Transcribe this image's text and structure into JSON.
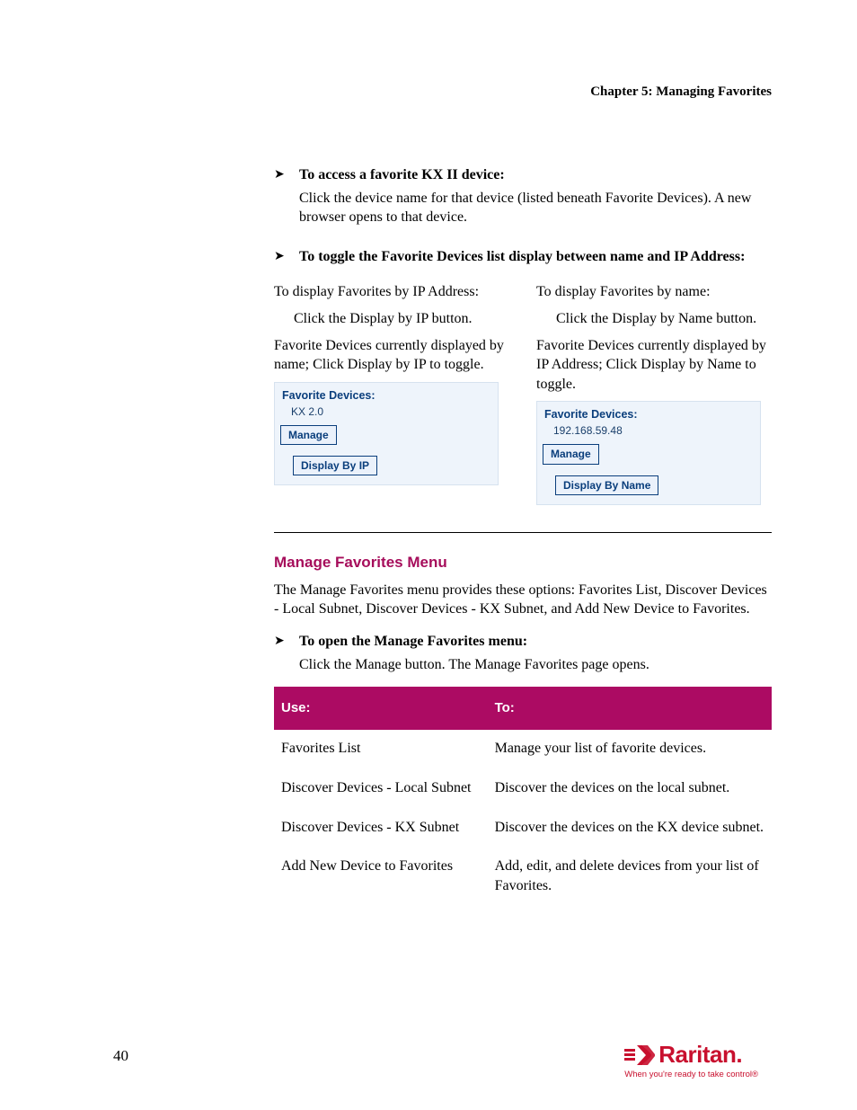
{
  "runningHead": "Chapter 5: Managing Favorites",
  "sec1": {
    "task1": {
      "title": "To access a favorite KX II device:",
      "body": "Click the device name for that device (listed beneath Favorite Devices). A new browser opens to that device."
    },
    "task2": {
      "title": "To toggle the Favorite Devices list display between name and IP Address:",
      "left": {
        "line1": "To display Favorites by IP Address:",
        "step": "Click the Display by IP button.",
        "line2": "Favorite Devices currently displayed by name; Click Display by IP to toggle."
      },
      "right": {
        "line1": "To display Favorites by name:",
        "step": "Click the Display by Name button.",
        "line2": "Favorite Devices currently displayed by IP Address; Click Display by Name to toggle."
      },
      "widgetLeft": {
        "title": "Favorite Devices:",
        "item": "KX 2.0",
        "btn1": "Manage",
        "btn2": "Display By IP"
      },
      "widgetRight": {
        "title": "Favorite Devices:",
        "item": "192.168.59.48",
        "btn1": "Manage",
        "btn2": "Display By Name"
      }
    }
  },
  "sec2": {
    "heading": "Manage Favorites Menu",
    "intro": "The Manage Favorites menu provides these options: Favorites List, Discover Devices - Local Subnet, Discover Devices - KX Subnet, and Add New Device to Favorites.",
    "task": {
      "title": "To open the Manage Favorites menu:",
      "body": "Click the Manage button. The Manage Favorites page opens."
    },
    "table": {
      "h1": "Use:",
      "h2": "To:",
      "rows": [
        {
          "c1": "Favorites List",
          "c2": "Manage your list of favorite devices."
        },
        {
          "c1": "Discover Devices - Local Subnet",
          "c2": "Discover the devices on the local subnet."
        },
        {
          "c1": "Discover Devices - KX Subnet",
          "c2": "Discover the devices on the KX device subnet."
        },
        {
          "c1": "Add New Device to Favorites",
          "c2": "Add, edit, and delete devices from your list of Favorites."
        }
      ]
    }
  },
  "pageNum": "40",
  "footer": {
    "brand": "Raritan.",
    "tagline": "When you're ready to take control®"
  }
}
